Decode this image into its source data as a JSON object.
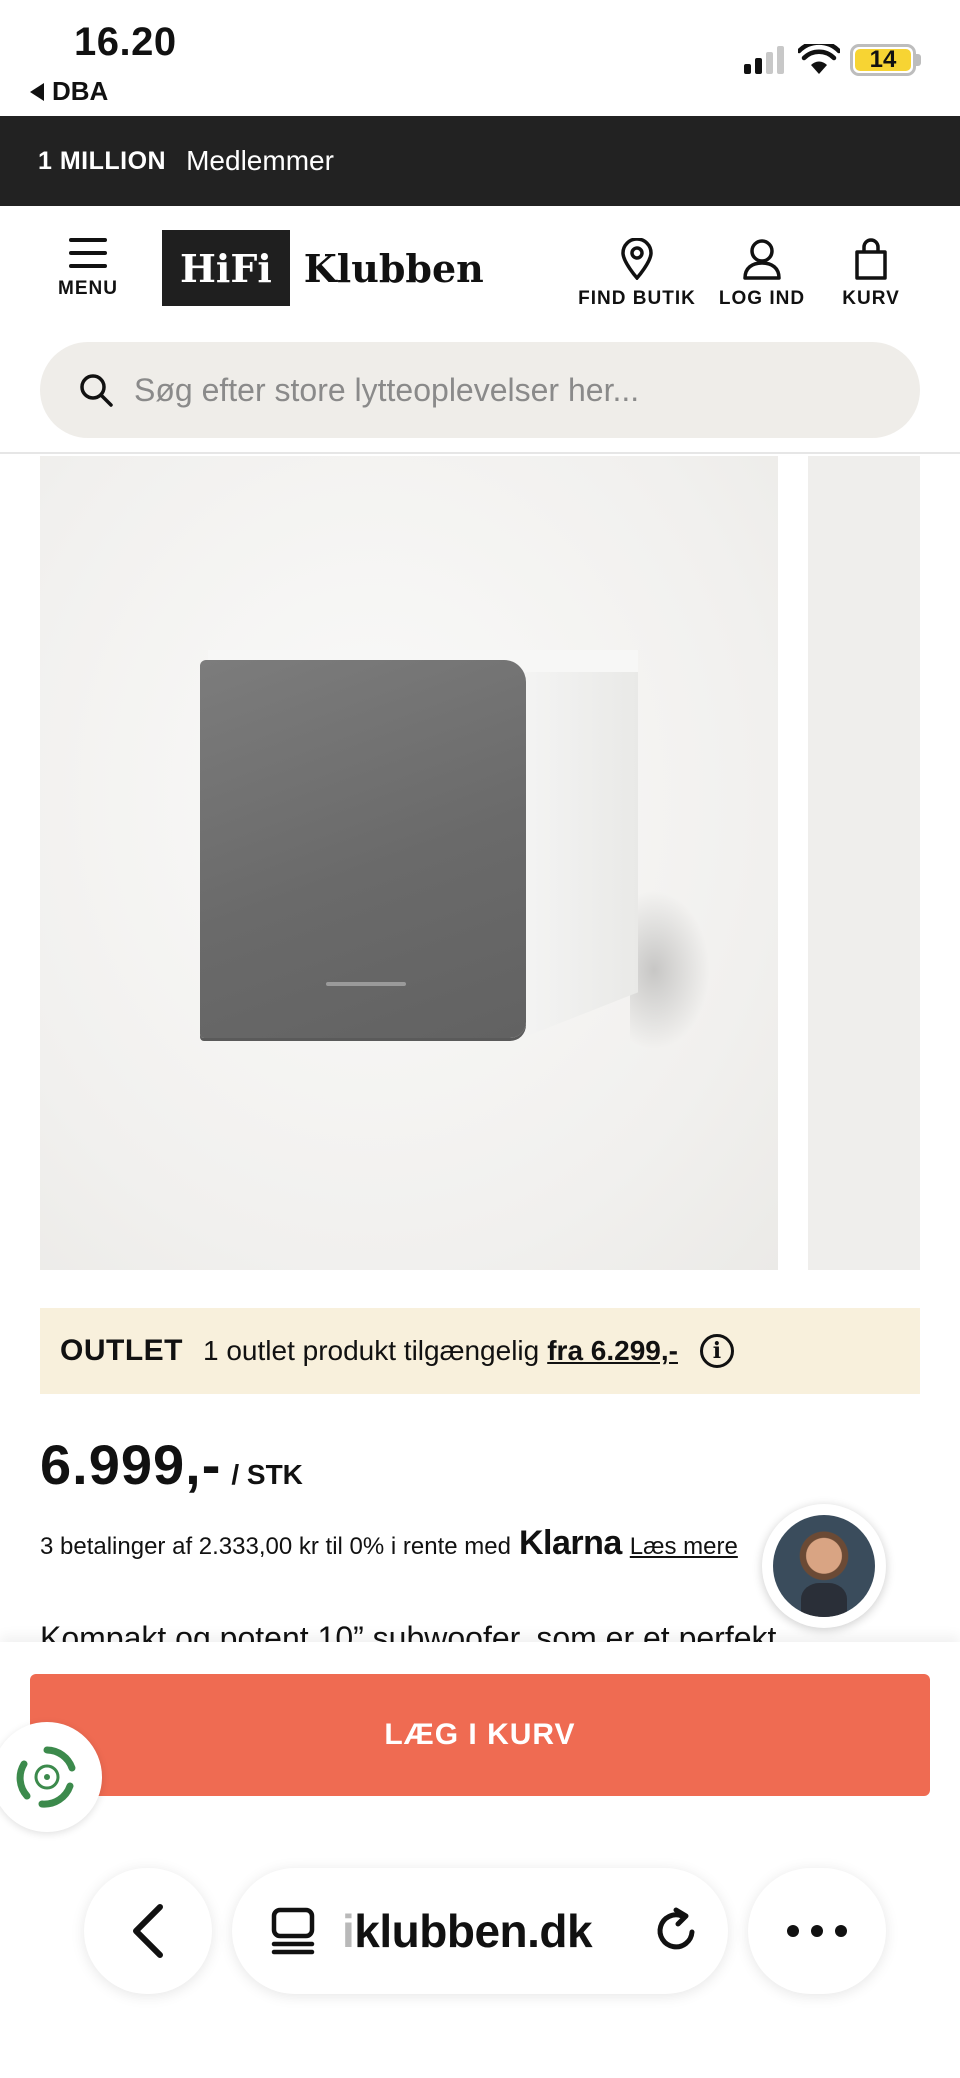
{
  "status": {
    "time": "16.20",
    "back_app": "DBA",
    "battery": "14"
  },
  "promo": {
    "strong": "1 MILLION",
    "text": "Medlemmer"
  },
  "header": {
    "menu_label": "MENU",
    "logo_box": "HiFi",
    "logo_text": "Klubben",
    "find_store": "FIND BUTIK",
    "login": "LOG IND",
    "cart": "KURV"
  },
  "search": {
    "placeholder": "Søg efter store lytteoplevelser her..."
  },
  "outlet": {
    "tag": "OUTLET",
    "text": "1 outlet produkt tilgængelig",
    "link": "fra 6.299,-",
    "info_icon": "i"
  },
  "price": {
    "value": "6.999,-",
    "unit": "/ STK"
  },
  "klarna": {
    "text": "3 betalinger af 2.333,00 kr til 0% i rente med",
    "logo": "Klarna",
    "link": "Læs mere"
  },
  "description": "Kompakt og potent 10” subwoofer, som er et perfekt",
  "cta": {
    "add_to_cart": "LÆG I KURV"
  },
  "browser": {
    "url_fade": "i",
    "url": "klubben.dk"
  },
  "colors": {
    "accent": "#ef6b52",
    "outlet_bg": "#f8f0dc",
    "banner_bg": "#222222"
  }
}
